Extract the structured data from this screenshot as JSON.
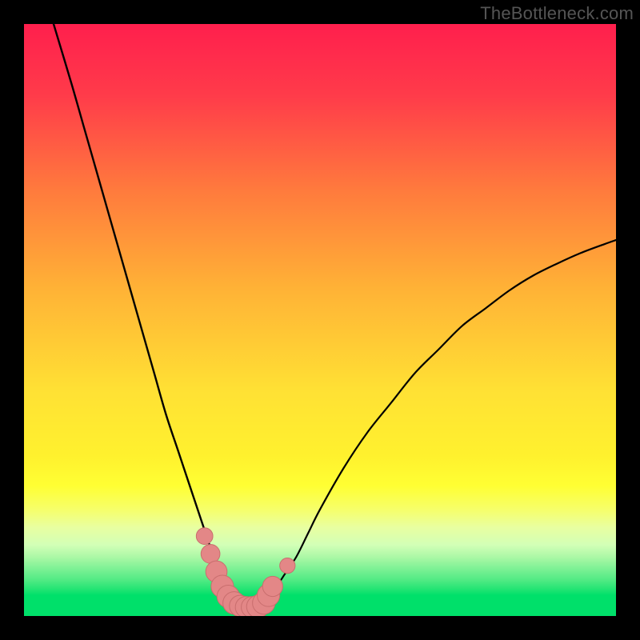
{
  "attribution": "TheBottleneck.com",
  "colors": {
    "border": "#000000",
    "curve": "#000000",
    "marker_fill": "#e38787",
    "marker_stroke": "#c96e6e",
    "green": "#00e46c",
    "green_light": "#8df0a0",
    "green_pale": "#e6fabf"
  },
  "chart_data": {
    "type": "line",
    "title": "",
    "xlabel": "",
    "ylabel": "",
    "xlim": [
      0,
      100
    ],
    "ylim": [
      0,
      100
    ],
    "left_curve": {
      "x": [
        5,
        8,
        10,
        12,
        14,
        16,
        18,
        20,
        22,
        24,
        26,
        28,
        30,
        32,
        33,
        34,
        35,
        36
      ],
      "y": [
        100,
        90,
        83,
        76,
        69,
        62,
        55,
        48,
        41,
        34,
        28,
        22,
        16,
        10,
        7,
        5,
        3,
        2
      ]
    },
    "right_curve": {
      "x": [
        40,
        42,
        44,
        46,
        48,
        50,
        54,
        58,
        62,
        66,
        70,
        74,
        78,
        82,
        86,
        90,
        94,
        98,
        100
      ],
      "y": [
        2,
        4,
        7,
        10,
        14,
        18,
        25,
        31,
        36,
        41,
        45,
        49,
        52,
        55,
        57.5,
        59.5,
        61.3,
        62.8,
        63.5
      ]
    },
    "markers": [
      {
        "x": 30.5,
        "y": 13.5,
        "r": 1.4
      },
      {
        "x": 31.5,
        "y": 10.5,
        "r": 1.6
      },
      {
        "x": 32.5,
        "y": 7.5,
        "r": 1.8
      },
      {
        "x": 33.5,
        "y": 5.0,
        "r": 1.9
      },
      {
        "x": 34.5,
        "y": 3.3,
        "r": 1.9
      },
      {
        "x": 35.5,
        "y": 2.2,
        "r": 1.9
      },
      {
        "x": 36.5,
        "y": 1.7,
        "r": 1.8
      },
      {
        "x": 37.5,
        "y": 1.5,
        "r": 1.8
      },
      {
        "x": 38.5,
        "y": 1.5,
        "r": 1.8
      },
      {
        "x": 39.5,
        "y": 1.6,
        "r": 1.9
      },
      {
        "x": 40.5,
        "y": 2.2,
        "r": 1.9
      },
      {
        "x": 41.3,
        "y": 3.5,
        "r": 1.9
      },
      {
        "x": 42.0,
        "y": 5.0,
        "r": 1.7
      },
      {
        "x": 44.5,
        "y": 8.5,
        "r": 1.3
      }
    ]
  }
}
